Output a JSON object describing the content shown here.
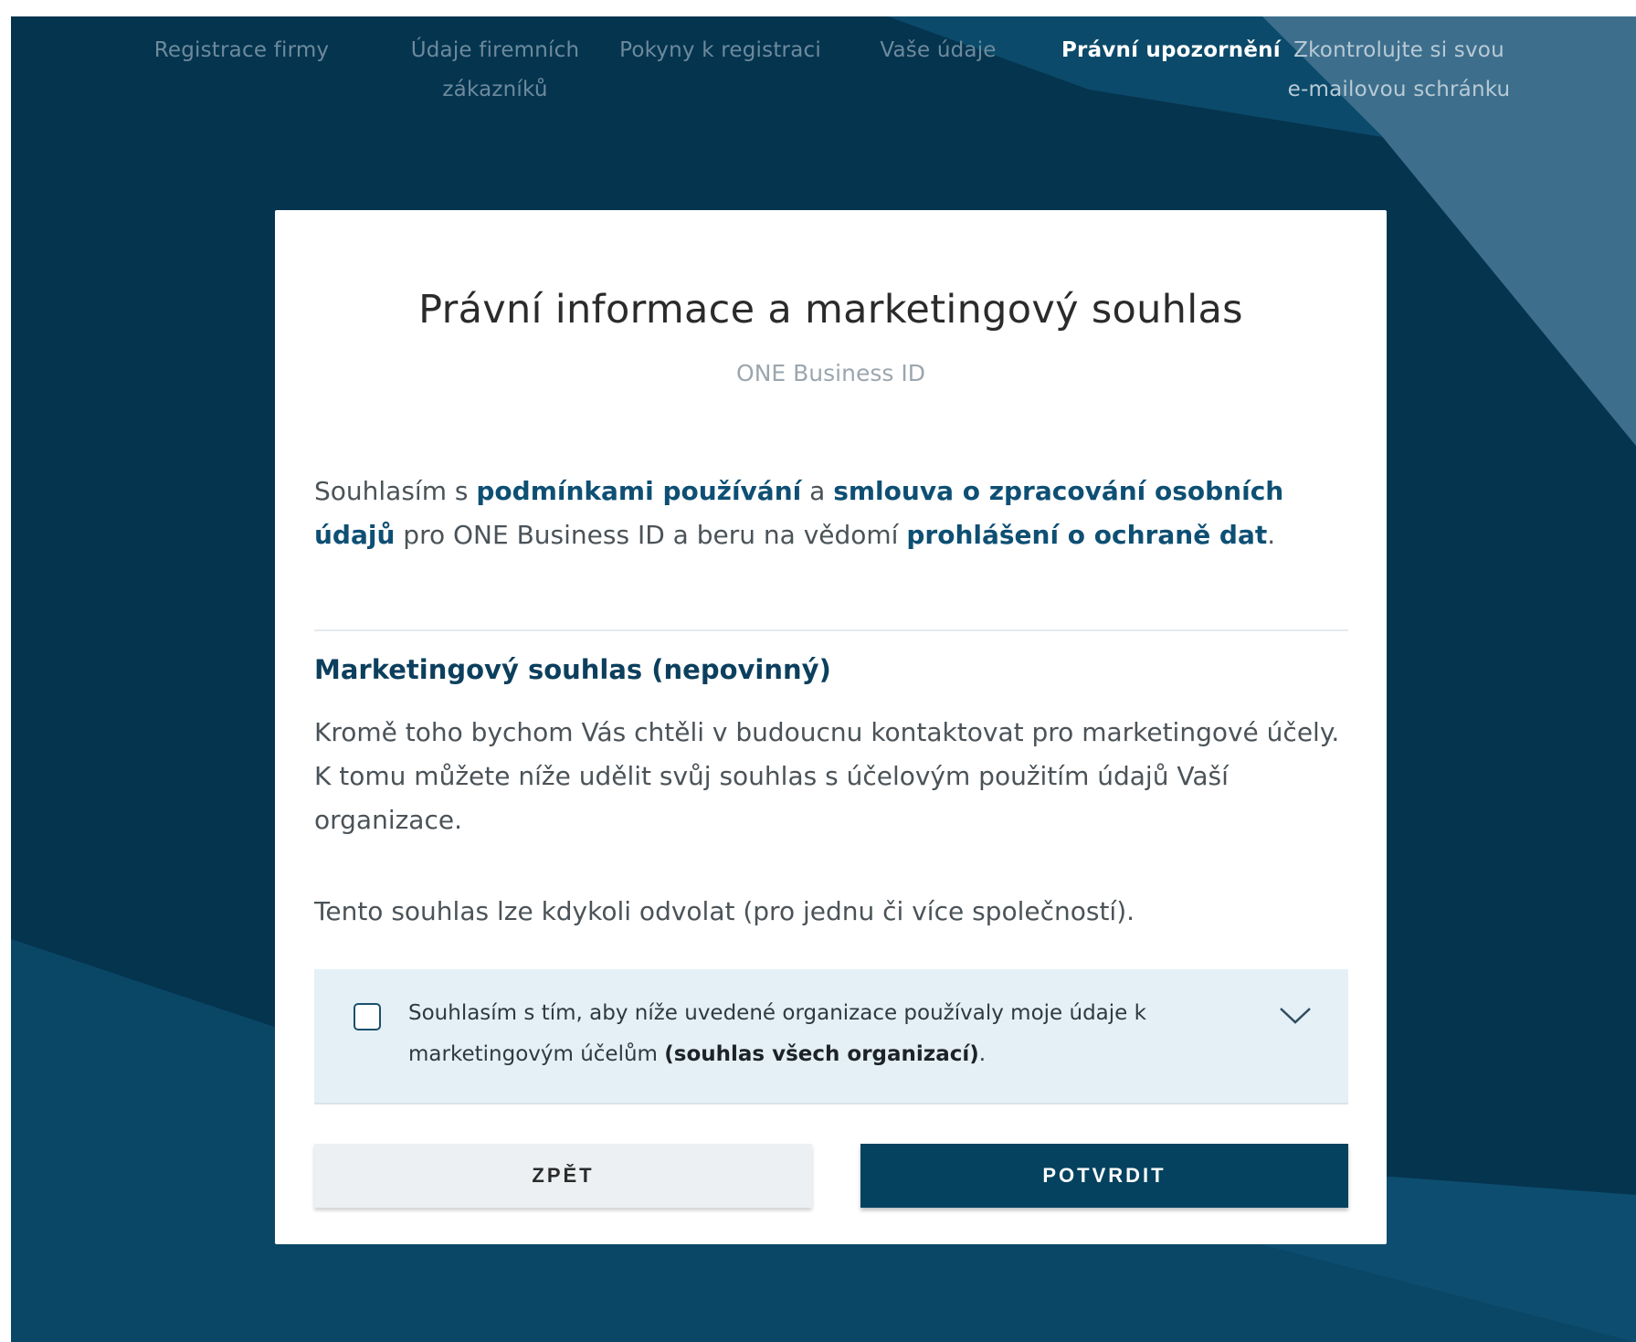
{
  "stepper": {
    "steps": [
      {
        "line1": "Registrace firmy",
        "line2": ""
      },
      {
        "line1": "Údaje firemních",
        "line2": "zákazníků"
      },
      {
        "line1": "Pokyny k registraci",
        "line2": ""
      },
      {
        "line1": "Vaše údaje",
        "line2": ""
      },
      {
        "line1": "Právní upozornění",
        "line2": ""
      },
      {
        "line1": "Zkontrolujte si svou",
        "line2": "e-mailovou schránku"
      }
    ],
    "active_index": 4
  },
  "card": {
    "title": "Právní informace a marketingový souhlas",
    "subtitle": "ONE Business ID",
    "legal": {
      "t1": "Souhlasím s ",
      "link_terms": "podmínkami používání",
      "t2": " a ",
      "link_dpa": "smlouva o zpracování osobních údajů",
      "t3": " pro ONE Business ID a beru na vědomí ",
      "link_privacy": "prohlášení o ochraně dat",
      "t4": "."
    },
    "marketing": {
      "heading": "Marketingový souhlas (nepovinný)",
      "text": "Kromě toho bychom Vás chtěli v budoucnu kontaktovat pro marketingové účely. K tomu můžete níže udělit svůj souhlas s účelovým použitím údajů Vaší organizace.",
      "revoke_text": "Tento souhlas lze kdykoli odvolat (pro jednu či více společností).",
      "consent": {
        "text": "Souhlasím s tím, aby níže uvedené organizace používaly moje údaje k marketingovým účelům ",
        "bold": "(souhlas všech organizací)",
        "end": ".",
        "checked": false
      }
    },
    "buttons": {
      "back": "ZPĚT",
      "confirm": "POTVRDIT"
    }
  },
  "colors": {
    "background": "#05344f",
    "accent": "#04425f",
    "link": "#0e4f74",
    "consent_bg": "#e4f0f6"
  },
  "icons": {
    "expand": "chevron-down-icon",
    "checkbox": "checkbox-unchecked"
  }
}
